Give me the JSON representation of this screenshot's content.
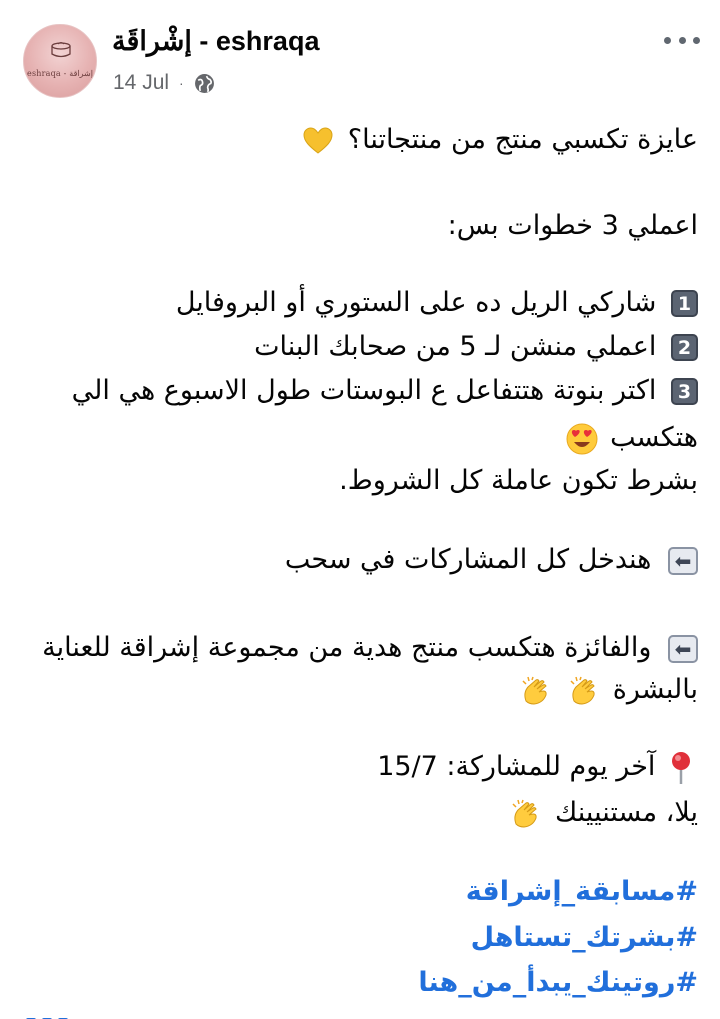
{
  "post_header": {
    "page_name": "إشْراقَة - eshraqa",
    "date": "14 Jul",
    "separator": "·",
    "privacy_icon": "globe-icon",
    "more_icon": "more-options-icon",
    "avatar_logo_text": "eshraqa - إشراقة"
  },
  "post_body": {
    "intro": "عايزة تكسبي منتج من منتجاتنا؟",
    "steps_title": "اعملي 3 خطوات بس:",
    "steps": [
      {
        "key": "1",
        "text": "شاركي الريل ده على الستوري أو البروفايل"
      },
      {
        "key": "2",
        "text": "اعملي منشن لـ 5 من صحابك البنات"
      },
      {
        "key": "3",
        "text": "اكتر بنوتة هتتفاعل ع البوستات طول الاسبوع هي الي"
      }
    ],
    "step3_continuation": "هتكسب",
    "condition": "بشرط تكون عاملة كل الشروط.",
    "draw_line": "هندخل كل المشاركات في سحب",
    "winner_line": "والفائزة هتكسب منتج هدية من مجموعة إشراقة للعناية",
    "winner_line_2": "بالبشرة",
    "deadline": "آخر يوم للمشاركة: 15/7",
    "closing": "يلا، مستنيينك",
    "hashtags": [
      "#مسابقة_إشراقة",
      "#بشرتك_تستاهل",
      "#روتينك_يبدأ_من_هنا"
    ]
  },
  "colors": {
    "hashtag": "#216fdb",
    "meta_text": "#65676b",
    "body_text": "#050505"
  }
}
